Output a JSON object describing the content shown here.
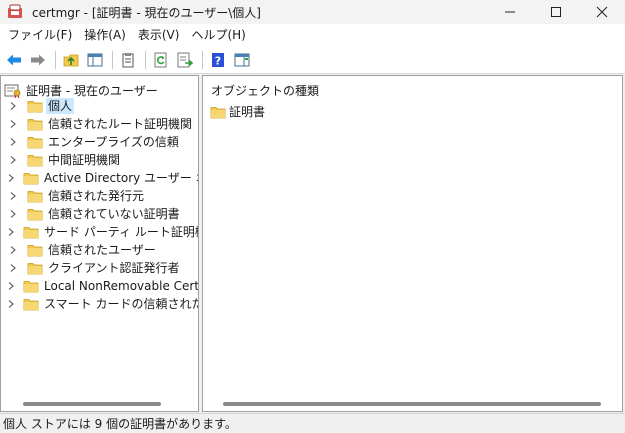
{
  "window": {
    "title": "certmgr - [証明書 - 現在のユーザー\\個人]"
  },
  "menu": [
    "ファイル(F)",
    "操作(A)",
    "表示(V)",
    "ヘルプ(H)"
  ],
  "toolbar": {
    "icons": [
      "back-arrow-icon",
      "forward-arrow-icon",
      "up-folder-icon",
      "show-hide-tree-icon",
      "properties-icon",
      "refresh-icon",
      "export-list-icon",
      "help-icon",
      "show-action-pane-icon"
    ]
  },
  "tree": {
    "root_label": "証明書 - 現在のユーザー",
    "items": [
      {
        "label": "個人",
        "selected": true
      },
      {
        "label": "信頼されたルート証明機関"
      },
      {
        "label": "エンタープライズの信頼"
      },
      {
        "label": "中間証明機関"
      },
      {
        "label": "Active Directory ユーザー オブジ"
      },
      {
        "label": "信頼された発行元"
      },
      {
        "label": "信頼されていない証明書"
      },
      {
        "label": "サード パーティ ルート証明機関"
      },
      {
        "label": "信頼されたユーザー"
      },
      {
        "label": "クライアント認証発行者"
      },
      {
        "label": "Local NonRemovable Certifica"
      },
      {
        "label": "スマート カードの信頼されたルート"
      }
    ]
  },
  "detail": {
    "column_header": "オブジェクトの種類",
    "items": [
      {
        "label": "証明書"
      }
    ]
  },
  "status": {
    "text": "個人 ストアには 9 個の証明書があります。"
  },
  "colors": {
    "selection": "#cce8ff",
    "folder": "#f2c94c",
    "back_arrow": "#1e88e5"
  }
}
